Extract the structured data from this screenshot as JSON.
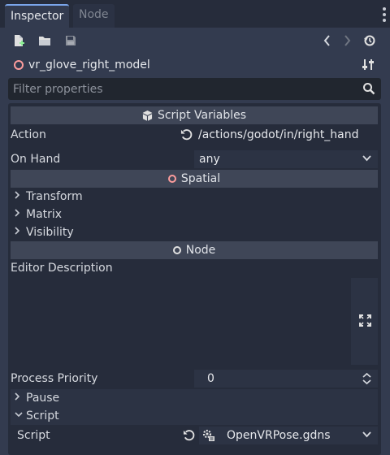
{
  "tabs": [
    {
      "label": "Inspector",
      "active": true
    },
    {
      "label": "Node",
      "active": false
    }
  ],
  "object_name": "vr_glove_right_model",
  "filter": {
    "placeholder": "Filter properties"
  },
  "sections": {
    "script_variables": "Script Variables",
    "spatial": "Spatial",
    "node": "Node"
  },
  "properties": {
    "action": {
      "label": "Action",
      "value": "/actions/godot/in/right_hand"
    },
    "on_hand": {
      "label": "On Hand",
      "value": "any"
    },
    "editor_description": {
      "label": "Editor Description"
    },
    "process_priority": {
      "label": "Process Priority",
      "value": "0"
    },
    "script": {
      "label": "Script",
      "value": "OpenVRPose.gdns"
    }
  },
  "groups": {
    "transform": "Transform",
    "matrix": "Matrix",
    "visibility": "Visibility",
    "pause": "Pause",
    "script": "Script"
  },
  "colors": {
    "accent": "#7aa5ea",
    "spatial_icon": "#fc9c9c",
    "node_icon": "#e0e0e0",
    "new_resource_icon": "#8eef97"
  }
}
